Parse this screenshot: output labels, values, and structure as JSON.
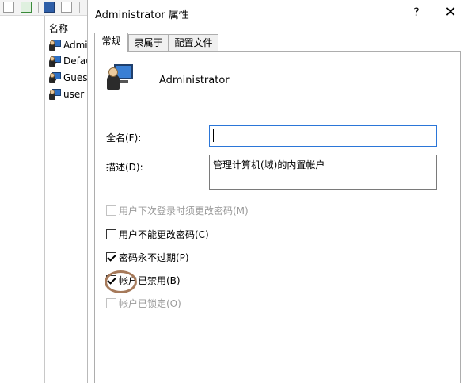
{
  "background": {
    "list_header": "名称",
    "users": [
      "Administrator",
      "DefaultAccount",
      "Guest",
      "user"
    ]
  },
  "dialog": {
    "title": "Administrator 属性",
    "help_glyph": "?",
    "close_glyph": "✕",
    "tabs": [
      {
        "label": "常规",
        "active": true
      },
      {
        "label": "隶属于",
        "active": false
      },
      {
        "label": "配置文件",
        "active": false
      }
    ],
    "general": {
      "username": "Administrator",
      "full_name_label": "全名(F):",
      "full_name_value": "",
      "description_label": "描述(D):",
      "description_value": "管理计算机(域)的内置帐户",
      "checkboxes": [
        {
          "label": "用户下次登录时须更改密码(M)",
          "checked": false,
          "disabled": true
        },
        {
          "label": "用户不能更改密码(C)",
          "checked": false,
          "disabled": false
        },
        {
          "label": "密码永不过期(P)",
          "checked": true,
          "disabled": false
        },
        {
          "label": "帐户已禁用(B)",
          "checked": true,
          "disabled": false
        },
        {
          "label": "帐户已锁定(O)",
          "checked": false,
          "disabled": true
        }
      ]
    }
  },
  "colors": {
    "highlight_circle": "#a67a5b",
    "focus_border": "#2b76d8"
  }
}
